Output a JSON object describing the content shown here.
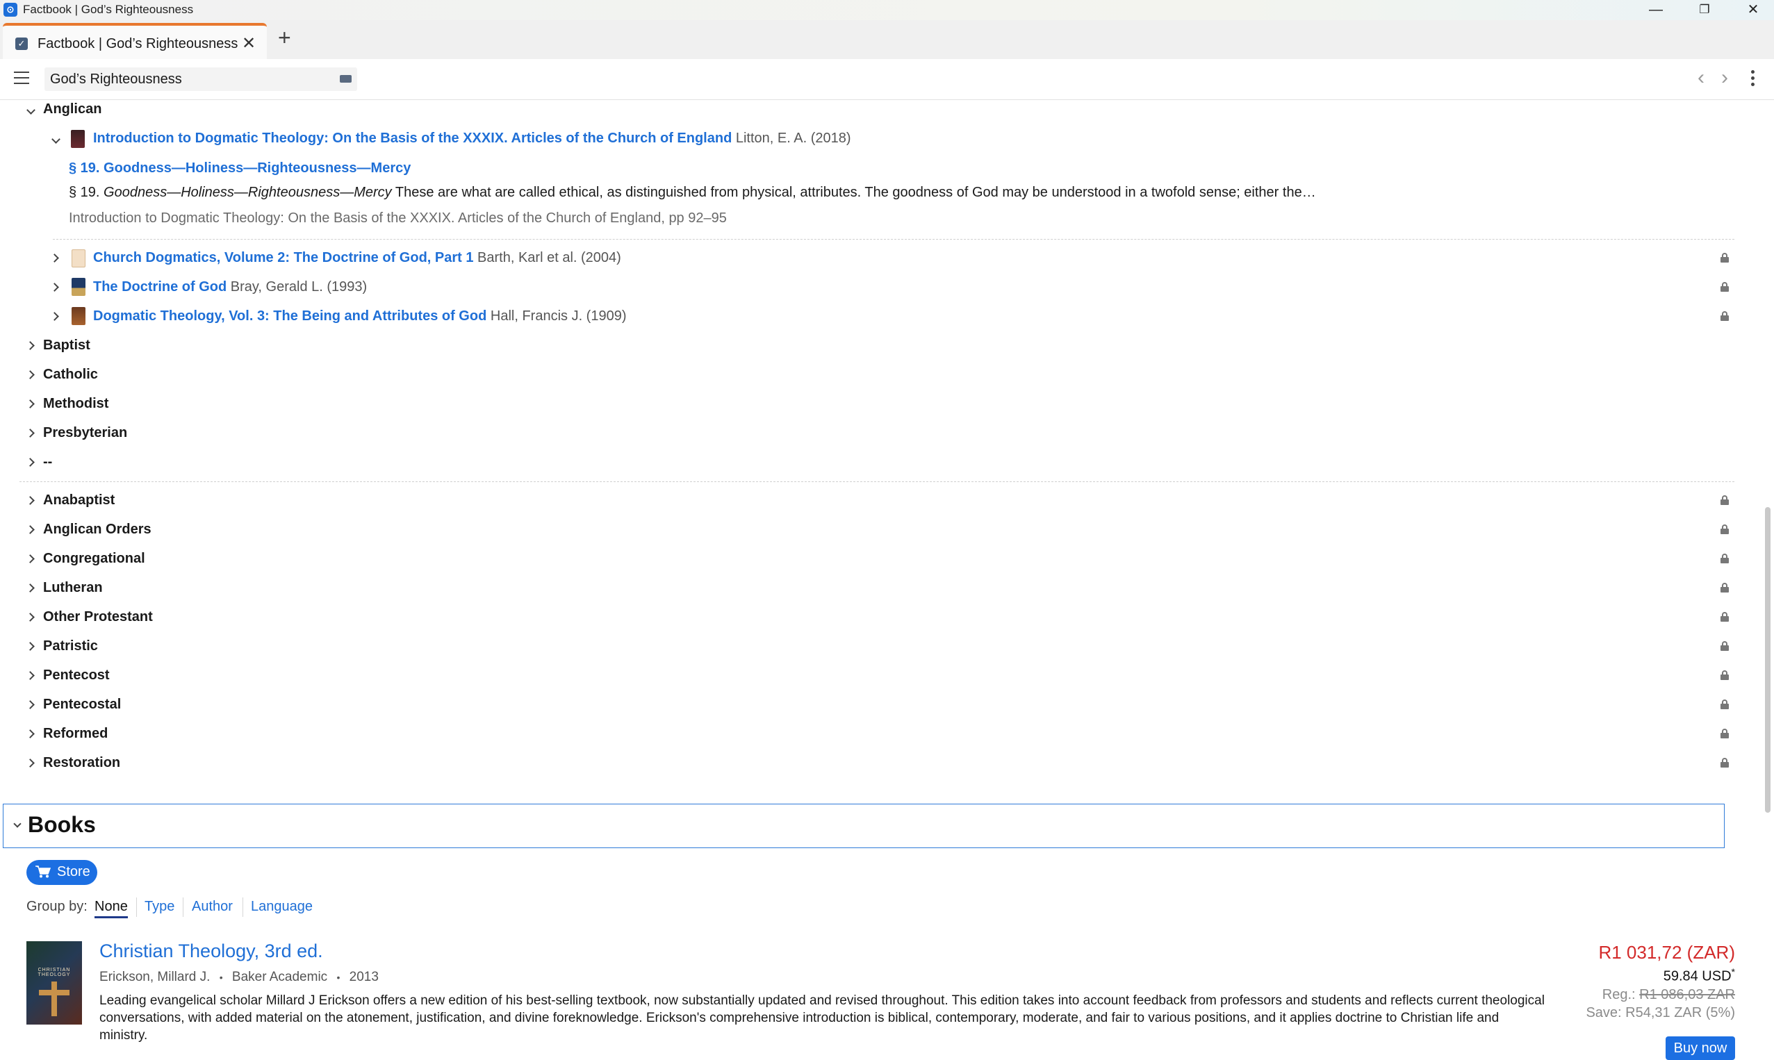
{
  "window": {
    "title": "Factbook | God’s Righteousness",
    "app_icon": "factbook-icon",
    "controls": [
      "minimize-icon",
      "restore-icon",
      "close-icon"
    ]
  },
  "tab": {
    "label": "Factbook | God’s Righteousness",
    "close": "✕",
    "new": "+"
  },
  "toolbar": {
    "search_value": "God’s Righteousness",
    "back": "‹",
    "forward": "›"
  },
  "traditions_open": {
    "name": "Anglican",
    "expanded_book": {
      "title": "Introduction to Dogmatic Theology: On the Basis of the XXXIX. Articles of the Church of England",
      "meta": "Litton, E. A. (2018)",
      "section_link": "§ 19. Goodness—Holiness—Righteousness—Mercy",
      "snippet_prefix": "§ 19. ",
      "snippet_italic": "Goodness—Holiness—Righteousness—Mercy",
      "snippet_rest": " These are what are called ethical, as distinguished from physical, attributes. The goodness of God may be understood in a twofold sense; either the…",
      "citation": "Introduction to Dogmatic Theology: On the Basis of the XXXIX. Articles of the Church of England, pp 92–95"
    },
    "books": [
      {
        "title": "Church Dogmatics, Volume 2: The Doctrine of God, Part 1",
        "meta": "Barth, Karl et al. (2004)"
      },
      {
        "title": "The Doctrine of God",
        "meta": "Bray, Gerald L. (1993)"
      },
      {
        "title": "Dogmatic Theology, Vol. 3: The Being and Attributes of God",
        "meta": "Hall, Francis J. (1909)"
      }
    ]
  },
  "traditions_unlocked": [
    "Baptist",
    "Catholic",
    "Methodist",
    "Presbyterian",
    "--"
  ],
  "traditions_locked": [
    "Anabaptist",
    "Anglican Orders",
    "Congregational",
    "Lutheran",
    "Other Protestant",
    "Patristic",
    "Pentecost",
    "Pentecostal",
    "Reformed",
    "Restoration"
  ],
  "books_section": {
    "title": "Books",
    "store_label": "Store",
    "group_by_label": "Group by:",
    "group_options": [
      "None",
      "Type",
      "Author",
      "Language"
    ],
    "selected_group": "None",
    "item": {
      "title": "Christian Theology, 3rd ed.",
      "author": "Erickson, Millard J.",
      "publisher": "Baker Academic",
      "year": "2013",
      "sep": "•",
      "description": "Leading evangelical scholar Millard J Erickson offers a new edition of his best-selling textbook, now substantially updated and revised throughout. This edition takes into account feedback from professors and students and reflects current theological conversations, with added material on the atonement, justification, and divine foreknowledge. Erickson's comprehensive introduction is biblical, contemporary, moderate, and fair to various positions, and it applies doctrine to Christian life and ministry.",
      "cover_text": "CHRISTIAN THEOLOGY",
      "price": "R1 031,72 (ZAR)",
      "usd": "59.84 USD",
      "usd_mark": "*",
      "reg_label": "Reg.:",
      "reg_price": "R1 086,03 ZAR",
      "save": "Save: R54,31 ZAR (5%)",
      "buy_label": "Buy now"
    }
  },
  "colors": {
    "link": "#1f6fd6",
    "accent": "#1c6fe2",
    "price": "#d32a2a",
    "tab_accent": "#e8782e"
  }
}
